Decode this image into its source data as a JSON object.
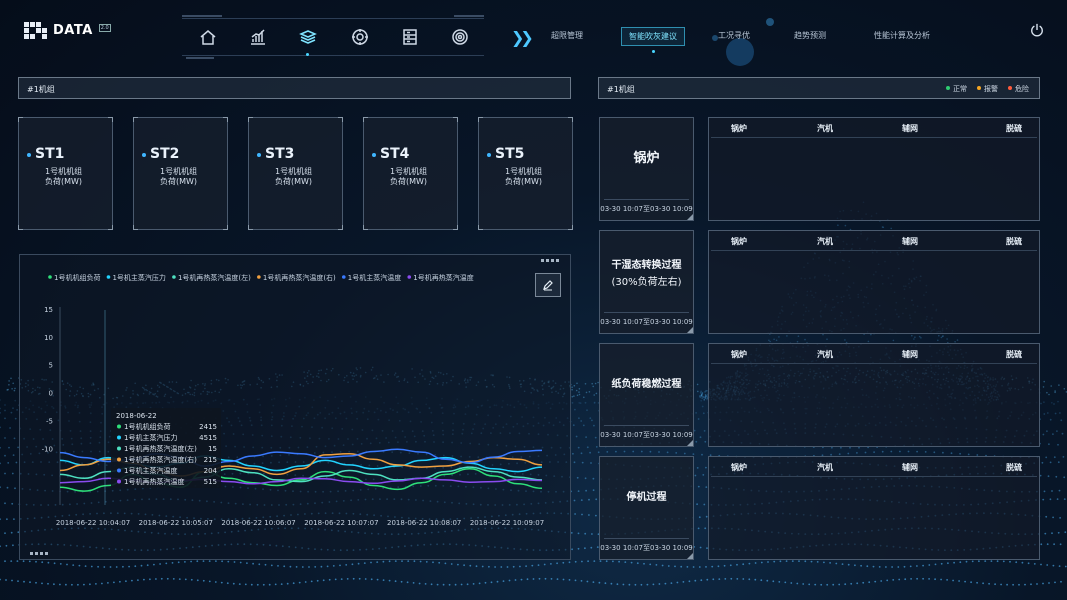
{
  "brand": {
    "name": "DATA",
    "version": "2.0"
  },
  "icon_nav": [
    {
      "icon": "home-icon"
    },
    {
      "icon": "bar-chart-icon"
    },
    {
      "icon": "layers-icon",
      "active": true
    },
    {
      "icon": "target-icon"
    },
    {
      "icon": "server-icon"
    },
    {
      "icon": "radar-icon"
    }
  ],
  "top_nav": [
    {
      "label": "超限管理"
    },
    {
      "label": "智能吹灰建议",
      "active": true
    },
    {
      "label": "工况寻优"
    },
    {
      "label": "趋势预测"
    },
    {
      "label": "性能计算及分析"
    }
  ],
  "left_panel": {
    "title": "#1机组",
    "cards": [
      {
        "title": "ST1",
        "line1": "1号机机组",
        "line2": "负荷(MW)"
      },
      {
        "title": "ST2",
        "line1": "1号机机组",
        "line2": "负荷(MW)"
      },
      {
        "title": "ST3",
        "line1": "1号机机组",
        "line2": "负荷(MW)"
      },
      {
        "title": "ST4",
        "line1": "1号机机组",
        "line2": "负荷(MW)"
      },
      {
        "title": "ST5",
        "line1": "1号机机组",
        "line2": "负荷(MW)"
      }
    ]
  },
  "right_panel": {
    "title": "#1机组",
    "status_legend": [
      {
        "label": "正常",
        "color": "#2ecc71"
      },
      {
        "label": "报警",
        "color": "#f5a623"
      },
      {
        "label": "危险",
        "color": "#ff5a3c"
      }
    ],
    "processes": [
      {
        "name": "锅炉",
        "date": "03-30 10:07至03-30 10:09"
      },
      {
        "name": "干湿态转换过程\n(30%负荷左右)",
        "date": "03-30 10:07至03-30 10:09"
      },
      {
        "name": "纸负荷稳燃过程",
        "date": "03-30 10:07至03-30 10:09"
      },
      {
        "name": "停机过程",
        "date": "03-30 10:07至03-30 10:09"
      }
    ],
    "table_headers": [
      "锅炉",
      "汽机",
      "辅网",
      "脱硫"
    ]
  },
  "chart_data": {
    "type": "line",
    "x": [
      "2018-06-22 10:04:07",
      "2018-06-22 10:05:07",
      "2018-06-22 10:06:07",
      "2018-06-22 10:07:07",
      "2018-06-22 10:08:07",
      "2018-06-22 10:09:07"
    ],
    "y_ticks": [
      15,
      10,
      5,
      0,
      -5,
      -10
    ],
    "ylim": [
      -20,
      15
    ],
    "grid": false,
    "legend_position": "top-left",
    "series": [
      {
        "name": "1号机机组负荷",
        "color": "#2ee07a",
        "values": [
          -16.8,
          -17.5,
          -16.5,
          -14.5,
          -16.0,
          -16.8,
          -14.0,
          -15.2,
          -16.0,
          -16.5,
          -15.5,
          -14.0,
          -15.0,
          -16.5,
          -17.2,
          -16.0,
          -14.5,
          -13.5,
          -14.8,
          -16.2,
          -17.0
        ]
      },
      {
        "name": "1号机主蒸汽压力",
        "color": "#22d4ff",
        "values": [
          -12.0,
          -12.8,
          -11.5,
          -12.6,
          -13.2,
          -12.5,
          -11.2,
          -12.0,
          -13.0,
          -13.8,
          -13.0,
          -12.0,
          -12.8,
          -13.5,
          -13.0,
          -12.0,
          -11.5,
          -12.5,
          -13.5,
          -14.0,
          -13.2
        ]
      },
      {
        "name": "1号机再热蒸汽温度(左)",
        "color": "#4ee0c0",
        "values": [
          -14.5,
          -15.2,
          -14.0,
          -13.2,
          -14.5,
          -15.8,
          -15.0,
          -13.5,
          -14.2,
          -15.5,
          -15.8,
          -14.8,
          -13.8,
          -14.5,
          -15.5,
          -15.2,
          -14.0,
          -13.2,
          -14.0,
          -15.0,
          -15.5
        ]
      },
      {
        "name": "1号机再热蒸汽温度(右)",
        "color": "#f0a040",
        "values": [
          -13.8,
          -12.8,
          -11.8,
          -12.5,
          -13.8,
          -14.8,
          -14.0,
          -13.0,
          -13.5,
          -14.5,
          -13.5,
          -11.0,
          -10.8,
          -11.8,
          -12.8,
          -13.2,
          -13.0,
          -12.2,
          -11.5,
          -11.8,
          -12.8
        ]
      },
      {
        "name": "1号机主蒸汽温度",
        "color": "#3a7aff",
        "values": [
          -10.6,
          -11.5,
          -12.2,
          -11.8,
          -10.8,
          -11.5,
          -13.0,
          -12.2,
          -11.2,
          -10.5,
          -10.8,
          -11.5,
          -11.2,
          -10.4,
          -10.0,
          -10.5,
          -11.8,
          -12.4,
          -11.4,
          -10.4,
          -10.2
        ]
      },
      {
        "name": "1号机再热蒸汽温度",
        "color": "#8a4cf0",
        "values": [
          -16.0,
          -15.8,
          -15.2,
          -15.6,
          -16.0,
          -15.6,
          -15.4,
          -15.8,
          -16.2,
          -15.8,
          -15.2,
          -15.3,
          -15.8,
          -16.1,
          -15.7,
          -15.2,
          -15.5,
          -15.9,
          -15.8,
          -15.4,
          -15.6
        ]
      }
    ],
    "tooltip": {
      "title": "2018-06-22",
      "rows": [
        {
          "name": "1号机机组负荷",
          "value": "2415",
          "color": "#2ee07a"
        },
        {
          "name": "1号机主蒸汽压力",
          "value": "4515",
          "color": "#22d4ff"
        },
        {
          "name": "1号机再热蒸汽温度(左)",
          "value": "15",
          "color": "#4ee0c0"
        },
        {
          "name": "1号机再热蒸汽温度(右)",
          "value": "215",
          "color": "#f0a040"
        },
        {
          "name": "1号机主蒸汽温度",
          "value": "204",
          "color": "#3a7aff"
        },
        {
          "name": "1号机再热蒸汽温度",
          "value": "515",
          "color": "#8a4cf0"
        }
      ]
    }
  }
}
